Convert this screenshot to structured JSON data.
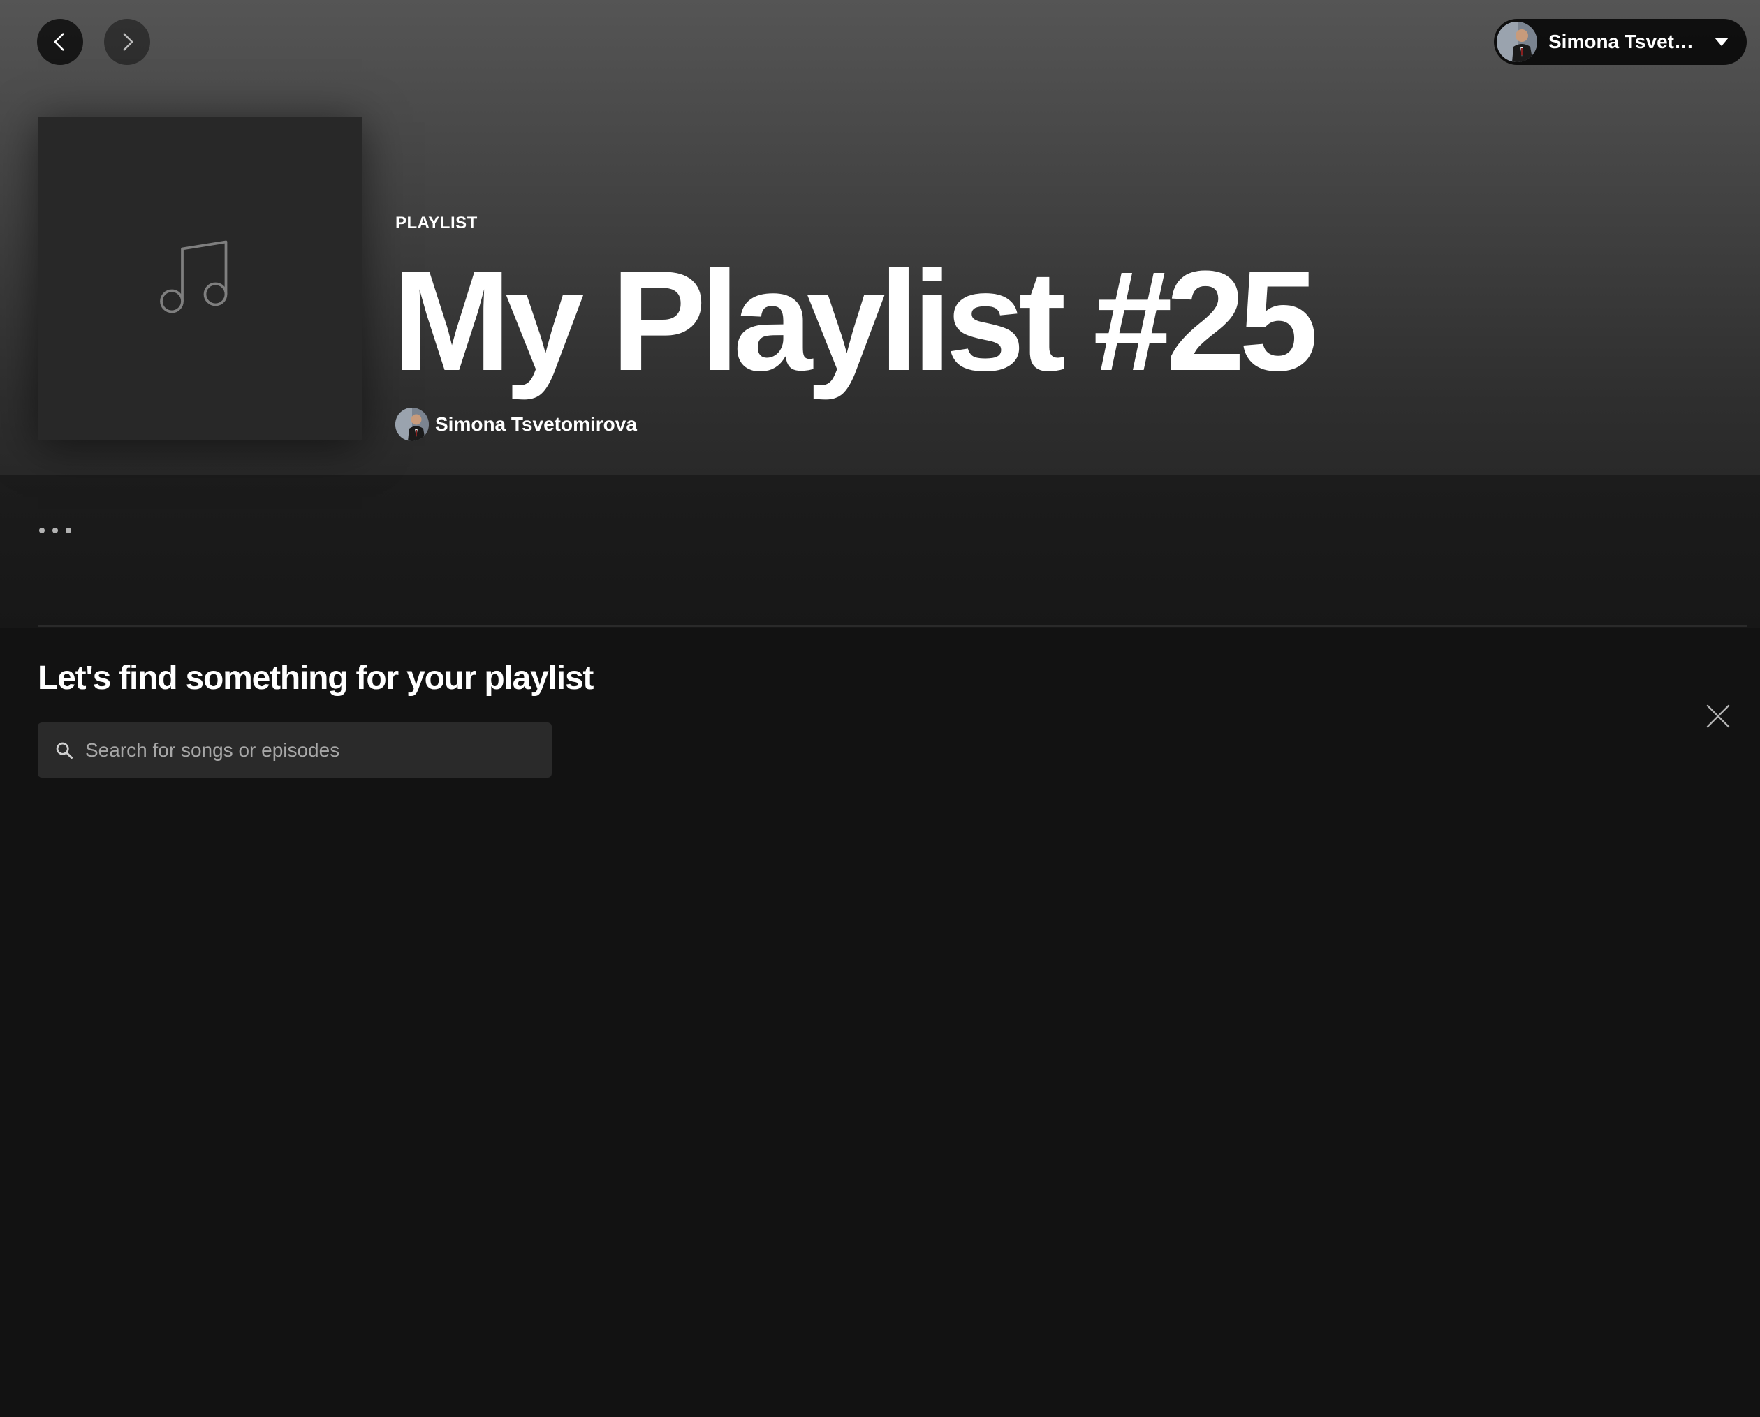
{
  "nav": {
    "back_icon": "chevron-left-icon",
    "forward_icon": "chevron-right-icon"
  },
  "user_menu": {
    "display_name": "Simona Tsveto...",
    "caret_icon": "caret-down-icon"
  },
  "playlist": {
    "type_label": "PLAYLIST",
    "title": "My Playlist #25",
    "owner": "Simona Tsvetomirova",
    "cover_icon": "music-note-icon"
  },
  "actions": {
    "more_icon": "more-options-icon"
  },
  "find": {
    "heading": "Let's find something for your playlist",
    "search_placeholder": "Search for songs or episodes",
    "search_value": "",
    "close_icon": "close-icon"
  },
  "colors": {
    "background": "#121212",
    "hero_top": "#555555",
    "hero_bottom": "#292929",
    "search_bg": "#2a2a2a",
    "muted_text": "#a7a7a7"
  }
}
